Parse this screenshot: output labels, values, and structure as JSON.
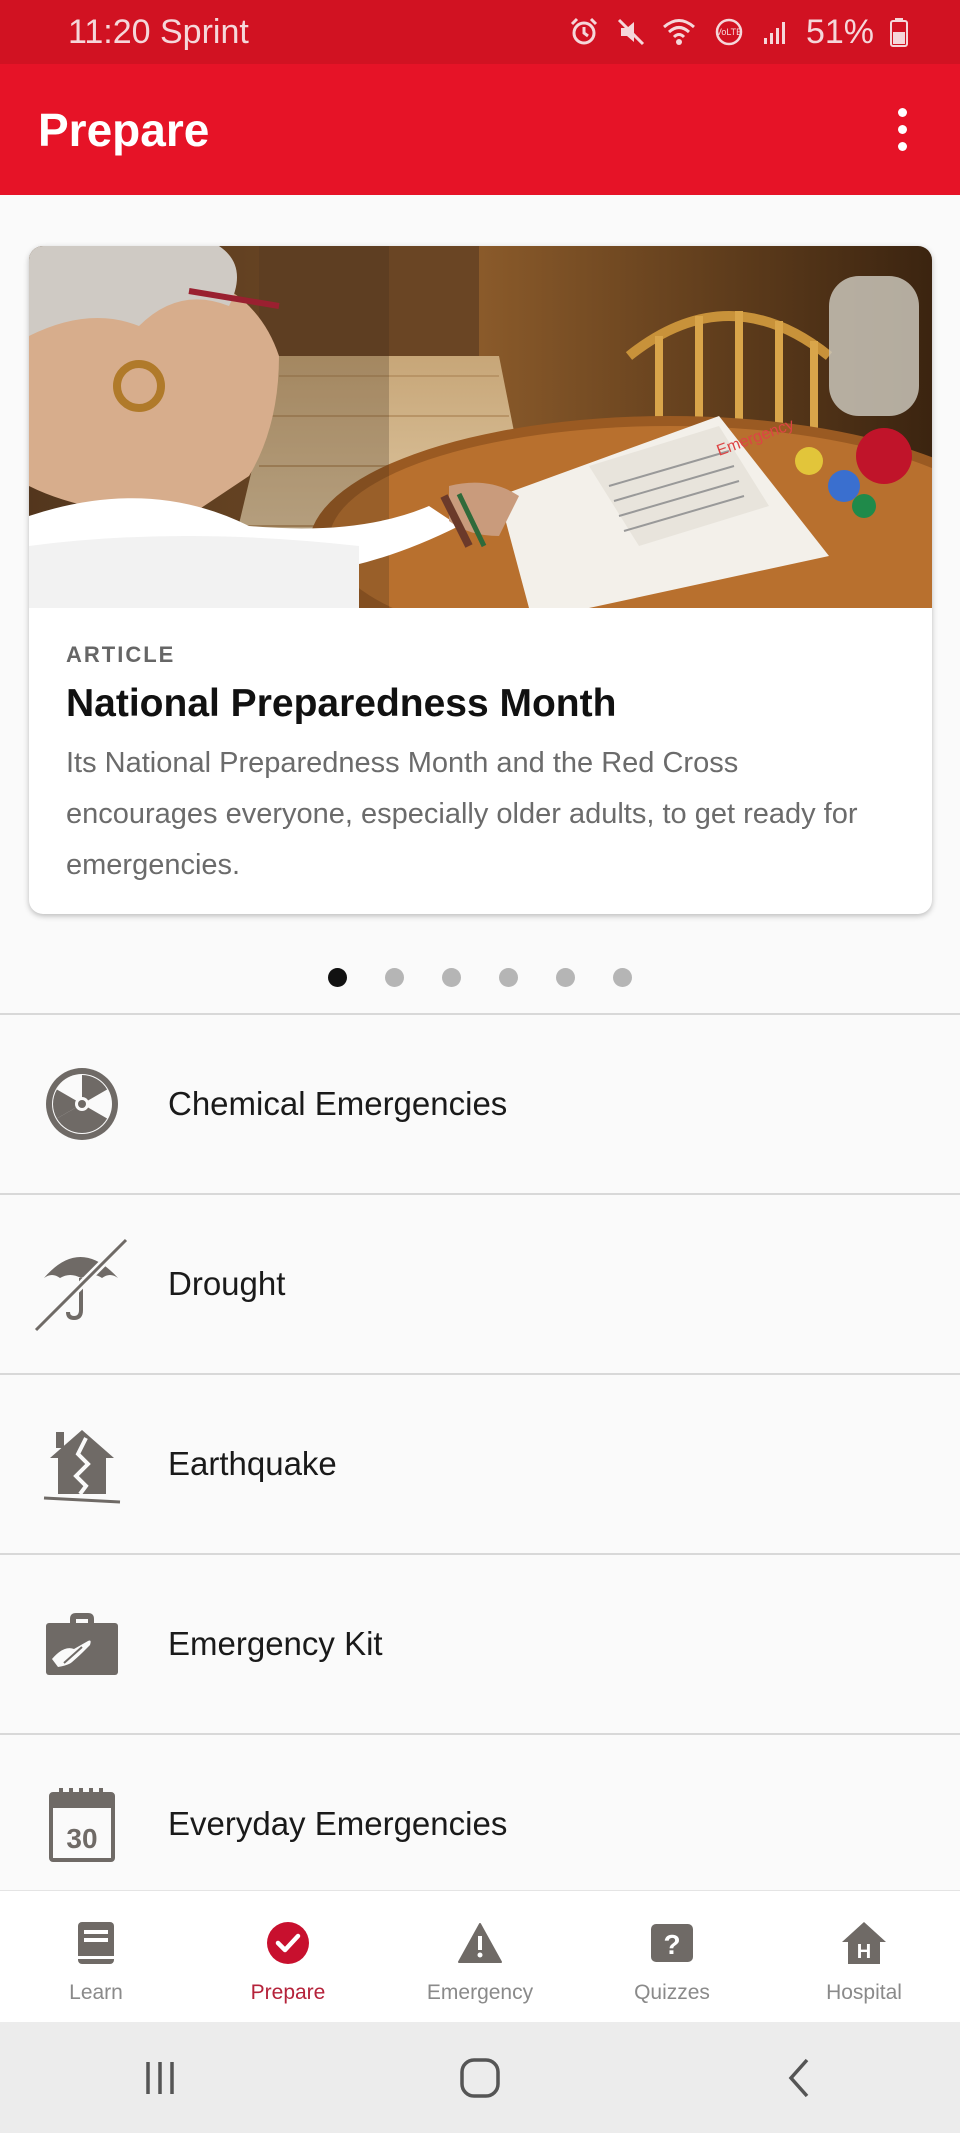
{
  "status_bar": {
    "time_carrier": "11:20 Sprint",
    "battery": "51%",
    "icons": [
      "alarm-icon",
      "mute-icon",
      "wifi-icon",
      "volte-icon",
      "signal-icon",
      "battery-icon"
    ]
  },
  "app_bar": {
    "title": "Prepare",
    "menu_icon": "more-vert-icon"
  },
  "featured_card": {
    "kicker": "ARTICLE",
    "title": "National Preparedness Month",
    "description": "Its National Preparedness Month and the Red Cross encourages everyone, especially older adults, to get ready for emergencies.",
    "image": "photo of an older woman reading an emergency checklist at a table"
  },
  "carousel": {
    "total": 6,
    "active_index": 0
  },
  "topics": [
    {
      "label": "Chemical Emergencies",
      "icon": "radiation-icon"
    },
    {
      "label": "Drought",
      "icon": "umbrella-off-icon"
    },
    {
      "label": "Earthquake",
      "icon": "cracked-house-icon"
    },
    {
      "label": "Emergency Kit",
      "icon": "first-aid-kit-icon"
    },
    {
      "label": "Everyday Emergencies",
      "icon": "calendar-30-icon"
    }
  ],
  "bottom_nav": [
    {
      "label": "Learn",
      "icon": "book-icon",
      "active": false
    },
    {
      "label": "Prepare",
      "icon": "check-circle-icon",
      "active": true
    },
    {
      "label": "Emergency",
      "icon": "warning-icon",
      "active": false
    },
    {
      "label": "Quizzes",
      "icon": "question-icon",
      "active": false
    },
    {
      "label": "Hospital",
      "icon": "hospital-icon",
      "active": false
    }
  ],
  "system_nav": [
    "recents-icon",
    "home-icon",
    "back-icon"
  ],
  "colors": {
    "status_bar": "#d11222",
    "app_bar": "#e61327",
    "accent": "#c8102e",
    "icon_gray": "#6f6a66",
    "background": "#fafafa"
  }
}
